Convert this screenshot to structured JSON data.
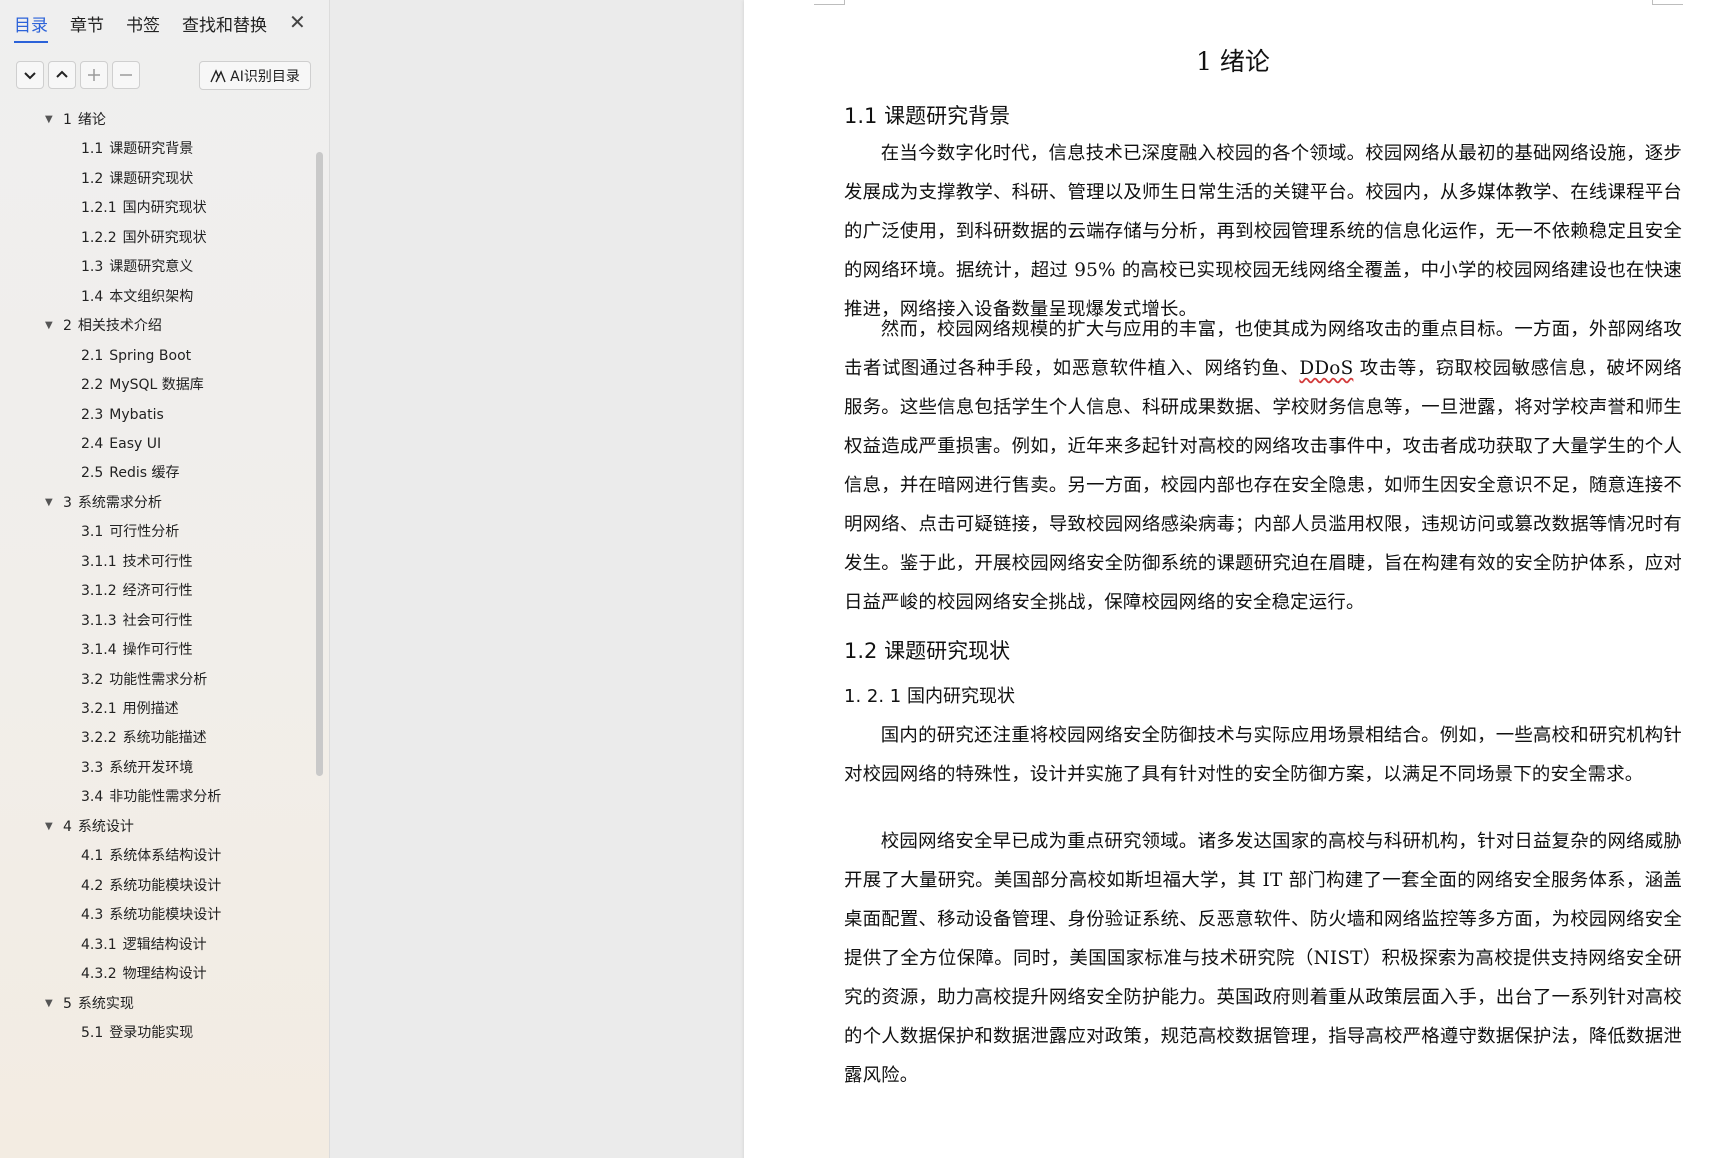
{
  "sidebar": {
    "tabs": [
      {
        "label": "目录",
        "active": true
      },
      {
        "label": "章节",
        "active": false
      },
      {
        "label": "书签",
        "active": false
      },
      {
        "label": "查找和替换",
        "active": false
      }
    ],
    "close_label": "✕",
    "ai_button_label": "AI识别目录",
    "toc": [
      {
        "num": "1",
        "title": "绪论",
        "level": 1,
        "expanded": true
      },
      {
        "num": "1.1",
        "title": "课题研究背景",
        "level": 2
      },
      {
        "num": "1.2",
        "title": "课题研究现状",
        "level": 2
      },
      {
        "num": "1.2.1",
        "title": "国内研究现状",
        "level": 2
      },
      {
        "num": "1.2.2",
        "title": "国外研究现状",
        "level": 2
      },
      {
        "num": "1.3",
        "title": "课题研究意义",
        "level": 2
      },
      {
        "num": "1.4",
        "title": "本文组织架构",
        "level": 2
      },
      {
        "num": "2",
        "title": "相关技术介绍",
        "level": 1,
        "expanded": true
      },
      {
        "num": "2.1",
        "title": "Spring Boot",
        "level": 2
      },
      {
        "num": "2.2",
        "title": "MySQL 数据库",
        "level": 2
      },
      {
        "num": "2.3",
        "title": "Mybatis",
        "level": 2
      },
      {
        "num": "2.4",
        "title": "Easy UI",
        "level": 2
      },
      {
        "num": "2.5",
        "title": "Redis  缓存",
        "level": 2
      },
      {
        "num": "3",
        "title": "系统需求分析",
        "level": 1,
        "expanded": true
      },
      {
        "num": "3.1",
        "title": "可行性分析",
        "level": 2
      },
      {
        "num": "3.1.1",
        "title": "技术可行性",
        "level": 2
      },
      {
        "num": "3.1.2",
        "title": "经济可行性",
        "level": 2
      },
      {
        "num": "3.1.3",
        "title": "社会可行性",
        "level": 2
      },
      {
        "num": "3.1.4",
        "title": "操作可行性",
        "level": 2
      },
      {
        "num": "3.2",
        "title": "功能性需求分析",
        "level": 2
      },
      {
        "num": "3.2.1",
        "title": "用例描述",
        "level": 2
      },
      {
        "num": "3.2.2",
        "title": "系统功能描述",
        "level": 2
      },
      {
        "num": "3.3",
        "title": "系统开发环境",
        "level": 2
      },
      {
        "num": "3.4",
        "title": "非功能性需求分析",
        "level": 2
      },
      {
        "num": "4",
        "title": "系统设计",
        "level": 1,
        "expanded": true
      },
      {
        "num": "4.1",
        "title": "系统体系结构设计",
        "level": 2
      },
      {
        "num": "4.2",
        "title": "系统功能模块设计",
        "level": 2
      },
      {
        "num": "4.3",
        "title": "系统功能模块设计",
        "level": 2
      },
      {
        "num": "4.3.1",
        "title": "逻辑结构设计",
        "level": 2
      },
      {
        "num": "4.3.2",
        "title": "物理结构设计",
        "level": 2
      },
      {
        "num": "5",
        "title": "系统实现",
        "level": 1,
        "expanded": true
      },
      {
        "num": "5.1",
        "title": "登录功能实现",
        "level": 2
      }
    ]
  },
  "document": {
    "chapter_title": "1  绪论",
    "section_1_1": "1.1  课题研究背景",
    "para_1": "在当今数字化时代，信息技术已深度融入校园的各个领域。校园网络从最初的基础网络设施，逐步发展成为支撑教学、科研、管理以及师生日常生活的关键平台。校园内，从多媒体教学、在线课程平台的广泛使用，到科研数据的云端存储与分析，再到校园管理系统的信息化运作，无一不依赖稳定且安全的网络环境。据统计，超过 95% 的高校已实现校园无线网络全覆盖，中小学的校园网络建设也在快速推进，网络接入设备数量呈现爆发式增长。",
    "para_2_a": "然而，校园网络规模的扩大与应用的丰富，也使其成为网络攻击的重点目标。一方面，外部网络攻击者试图通过各种手段，如恶意软件植入、网络钓鱼、",
    "para_2_err": "DDoS",
    "para_2_b": " 攻击等，窃取校园敏感信息，破坏网络服务。这些信息包括学生个人信息、科研成果数据、学校财务信息等，一旦泄露，将对学校声誉和师生权益造成严重损害。例如，近年来多起针对高校的网络攻击事件中，攻击者成功获取了大量学生的个人信息，并在暗网进行售卖。另一方面，校园内部也存在安全隐患，如师生因安全意识不足，随意连接不明网络、点击可疑链接，导致校园网络感染病毒；内部人员滥用权限，违规访问或篡改数据等情况时有发生。鉴于此，开展校园网络安全防御系统的课题研究迫在眉睫，旨在构建有效的安全防护体系，应对日益严峻的校园网络安全挑战，保障校园网络的安全稳定运行。",
    "section_1_2": "1.2  课题研究现状",
    "section_1_2_1": "1. 2. 1  国内研究现状",
    "para_3": "国内的研究还注重将校园网络安全防御技术与实际应用场景相结合。例如，一些高校和研究机构针对校园网络的特殊性，设计并实施了具有针对性的安全防御方案，以满足不同场景下的安全需求。",
    "para_4": "校园网络安全早已成为重点研究领域。诸多发达国家的高校与科研机构，针对日益复杂的网络威胁开展了大量研究。美国部分高校如斯坦福大学，其 IT 部门构建了一套全面的网络安全服务体系，涵盖桌面配置、移动设备管理、身份验证系统、反恶意软件、防火墙和网络监控等多方面，为校园网络安全提供了全方位保障。同时，美国国家标准与技术研究院（NIST）积极探索为高校提供支持网络安全研究的资源，助力高校提升网络安全防护能力。英国政府则着重从政策层面入手，出台了一系列针对高校的个人数据保护和数据泄露应对政策，规范高校数据管理，指导高校严格遵守数据保护法，降低数据泄露风险。"
  }
}
